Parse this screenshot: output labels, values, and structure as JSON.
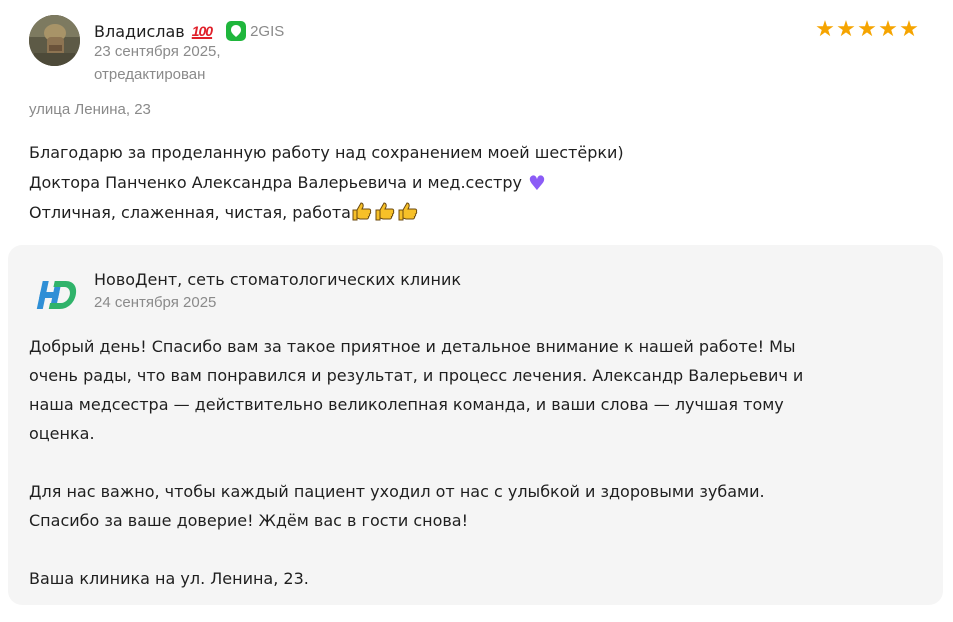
{
  "review": {
    "author_name": "Владислав",
    "author_badge": "💯",
    "source": {
      "label": "2GIS",
      "icon": "2gis-logo-icon",
      "color": "#1fb63c"
    },
    "date": "23 сентября 2025,",
    "edited": "отредактирован",
    "rating": 5,
    "rating_stars": "★★★★★",
    "star_color": "#f5a400",
    "address": "улица Ленина, 23",
    "text_lines": [
      "Благодарю за проделанную работу над сохранением моей шестёрки)",
      "Доктора Панченко Александра Валерьевича и мед.сестру",
      "Отличная, слаженная, чистая, работа"
    ],
    "heart_emoji": "💜",
    "thumbs_count": 3
  },
  "reply": {
    "company_name": "НовоДент, сеть стоматологических клиник",
    "date": "24 сентября 2025",
    "paragraphs": [
      [
        "Добрый день! Спасибо вам за такое приятное и детальное внимание к нашей работе! Мы",
        "очень рады, что вам понравился и результат, и процесс лечения. Александр Валерьевич и",
        "наша медсестра — действительно великолепная команда, и ваши слова — лучшая тому",
        "оценка."
      ],
      [
        "Для нас важно, чтобы каждый пациент уходил от нас с улыбкой и здоровыми зубами.",
        "Спасибо за ваше доверие! Ждём вас в гости снова!"
      ],
      [
        "Ваша клиника на ул. Ленина, 23."
      ]
    ],
    "logo_colors": {
      "h": "#2f8fd6",
      "d": "#2fb36a"
    }
  }
}
